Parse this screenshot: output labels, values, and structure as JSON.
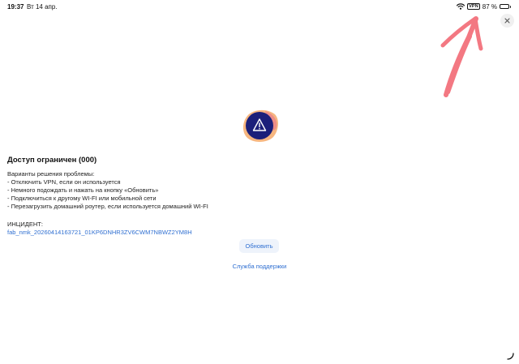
{
  "status_bar": {
    "time": "19:37",
    "date": "Вт 14 апр.",
    "vpn_label": "VPN",
    "battery_text": "87 %",
    "battery_level": 0.87,
    "wifi_icon": "wifi-icon",
    "battery_icon": "battery-icon"
  },
  "close_icon": "close-icon",
  "annotation": {
    "icon": "hand-drawn-arrow",
    "color": "#f26d78"
  },
  "illustration": {
    "icon": "warning-triangle-icon",
    "circle_color": "#1b1f7a",
    "blob_color": "#f4a96a"
  },
  "main": {
    "title": "Доступ ограничен (000)",
    "options_heading": "Варианты решения проблемы:",
    "options": [
      "- Отключить VPN, если он используется",
      "- Немного подождать и нажать на кнопку «Обновить»",
      "- Подключиться к другому WI-FI или мобильной сети",
      "- Перезагрузить домашний роутер, если используется домашний WI-FI"
    ],
    "incident_label": "ИНЦИДЕНТ:",
    "incident_id": "fab_nmk_20260414163721_01KP6DNHR3ZV6CWM7NBWZ2YM8H"
  },
  "buttons": {
    "refresh": "Обновить",
    "support": "Служба поддержки"
  },
  "colors": {
    "accent": "#2f6fd1",
    "button_bg": "#eef3fb"
  }
}
